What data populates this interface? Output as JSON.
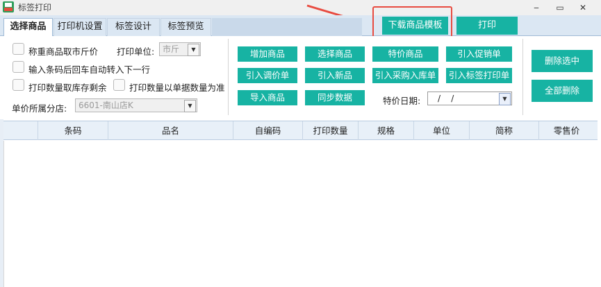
{
  "window": {
    "title": "标签打印",
    "minimize": "‒",
    "maximize": "▭",
    "close": "✕"
  },
  "tabs": [
    {
      "label": "选择商品",
      "active": true
    },
    {
      "label": "打印机设置",
      "active": false
    },
    {
      "label": "标签设计",
      "active": false
    },
    {
      "label": "标签预览",
      "active": false
    }
  ],
  "top_buttons": {
    "download_template": "下载商品模板",
    "print": "打印"
  },
  "options": {
    "weigh_jin": "称重商品取市斤价",
    "auto_next_row": "输入条码后回车自动转入下一行",
    "qty_stock": "打印数量取库存剩余",
    "qty_doc": "打印数量以单据数量为准",
    "print_unit_label": "打印单位:",
    "print_unit_value": "市斤",
    "branch_label": "单价所属分店:",
    "branch_value": "6601-南山店K"
  },
  "action_buttons": {
    "add_goods": "增加商品",
    "select_goods": "选择商品",
    "special_goods": "特价商品",
    "import_promo": "引入促销单",
    "import_price_adjust": "引入调价单",
    "import_new": "引入新品",
    "import_purchase": "引入采购入库单",
    "import_label_print": "引入标签打印单",
    "import_goods": "导入商品",
    "sync_data": "同步数据"
  },
  "special_date": {
    "label": "特价日期:",
    "value": "/    /"
  },
  "side_buttons": {
    "delete_selected": "删除选中",
    "delete_all": "全部删除"
  },
  "table": {
    "columns": [
      "",
      "条码",
      "品名",
      "自编码",
      "打印数量",
      "规格",
      "单位",
      "简称",
      "零售价"
    ],
    "rows": []
  },
  "colors": {
    "accent": "#17b3a3",
    "highlight": "#e84b40",
    "tab_bar": "#dbe7f3"
  }
}
